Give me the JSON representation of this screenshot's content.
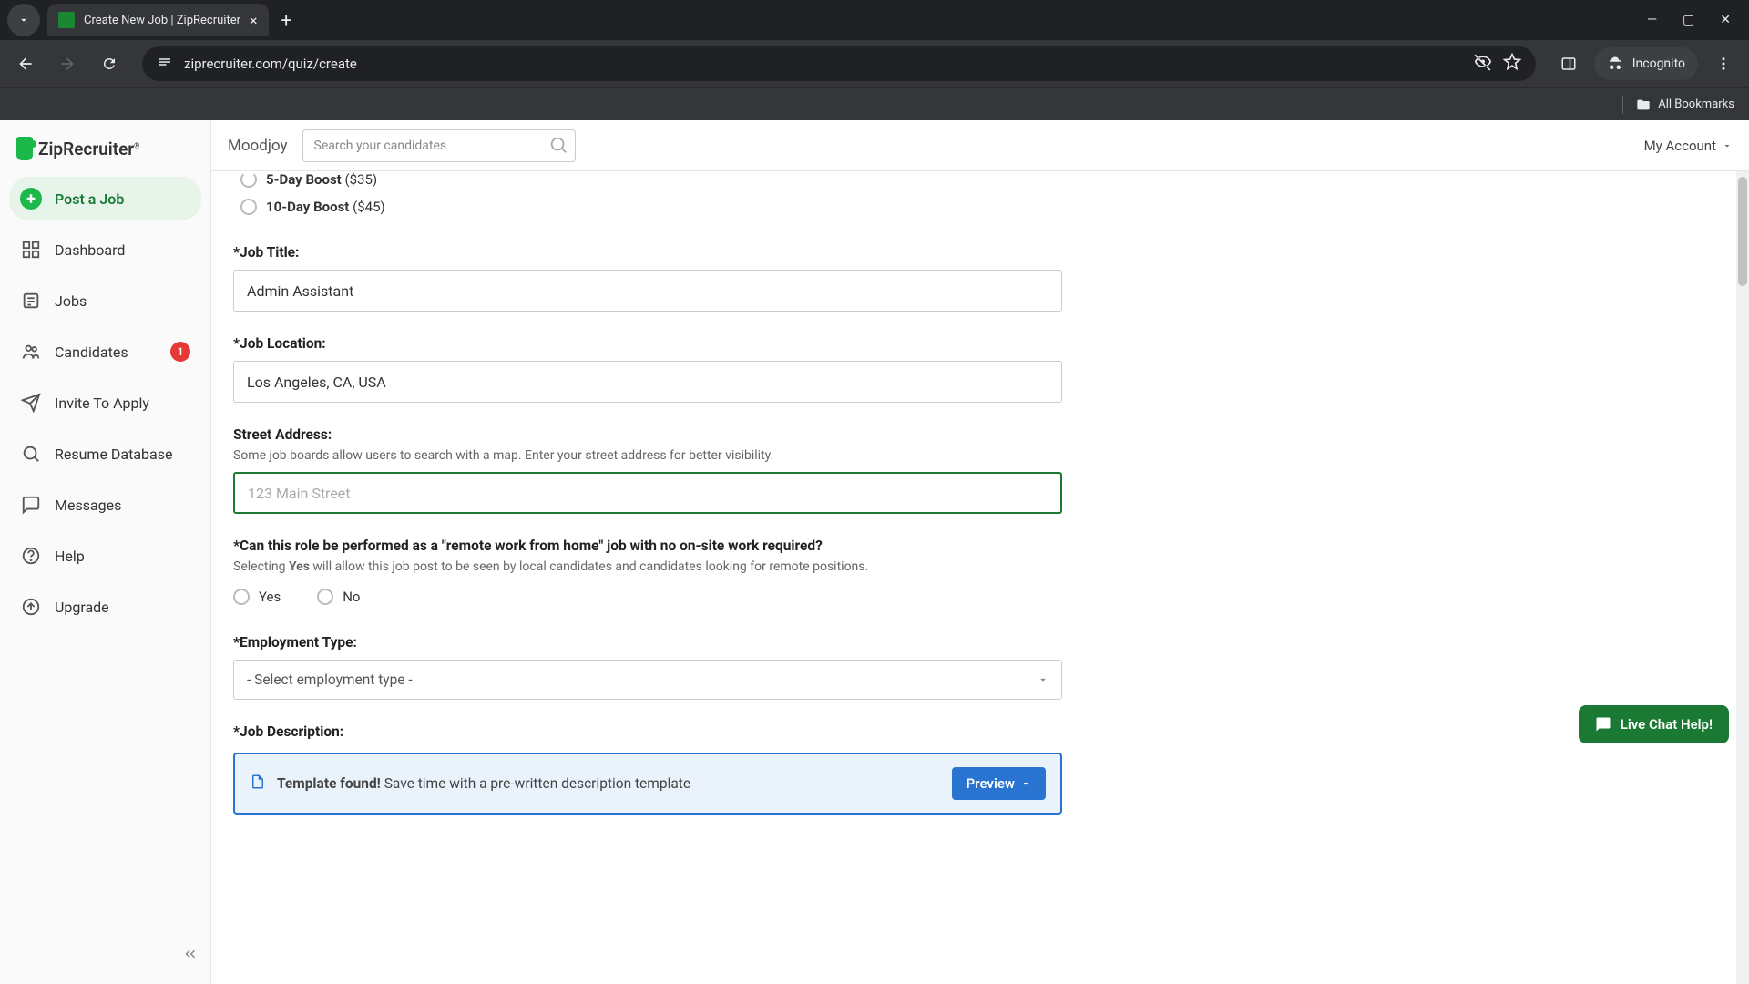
{
  "browser": {
    "tab_title": "Create New Job | ZipRecruiter",
    "url": "ziprecruiter.com/quiz/create",
    "incognito_label": "Incognito",
    "all_bookmarks": "All Bookmarks"
  },
  "logo_text": "ZipRecruiter",
  "sidebar": {
    "post_job": "Post a Job",
    "dashboard": "Dashboard",
    "jobs": "Jobs",
    "candidates": "Candidates",
    "candidates_badge": "1",
    "invite": "Invite To Apply",
    "resume_db": "Resume Database",
    "messages": "Messages",
    "help": "Help",
    "upgrade": "Upgrade"
  },
  "topbar": {
    "org": "Moodjoy",
    "search_placeholder": "Search your candidates",
    "account": "My Account"
  },
  "form": {
    "boost5_label": "5-Day Boost",
    "boost5_price": "($35)",
    "boost10_label": "10-Day Boost",
    "boost10_price": "($45)",
    "job_title_label": "*Job Title:",
    "job_title_value": "Admin Assistant",
    "job_location_label": "*Job Location:",
    "job_location_value": "Los Angeles, CA, USA",
    "street_label": "Street Address:",
    "street_help": "Some job boards allow users to search with a map. Enter your street address for better visibility.",
    "street_placeholder": "123 Main Street",
    "remote_label": "*Can this role be performed as a \"remote work from home\" job with no on-site work required?",
    "remote_help_prefix": "Selecting ",
    "remote_help_bold": "Yes",
    "remote_help_suffix": " will allow this job post to be seen by local candidates and candidates looking for remote positions.",
    "remote_yes": "Yes",
    "remote_no": "No",
    "emp_type_label": "*Employment Type:",
    "emp_type_placeholder": "- Select employment type -",
    "job_desc_label": "*Job Description:",
    "template_bold": "Template found!",
    "template_text": " Save time with a pre-written description template",
    "preview_btn": "Preview"
  },
  "chat_label": "Live Chat Help!"
}
